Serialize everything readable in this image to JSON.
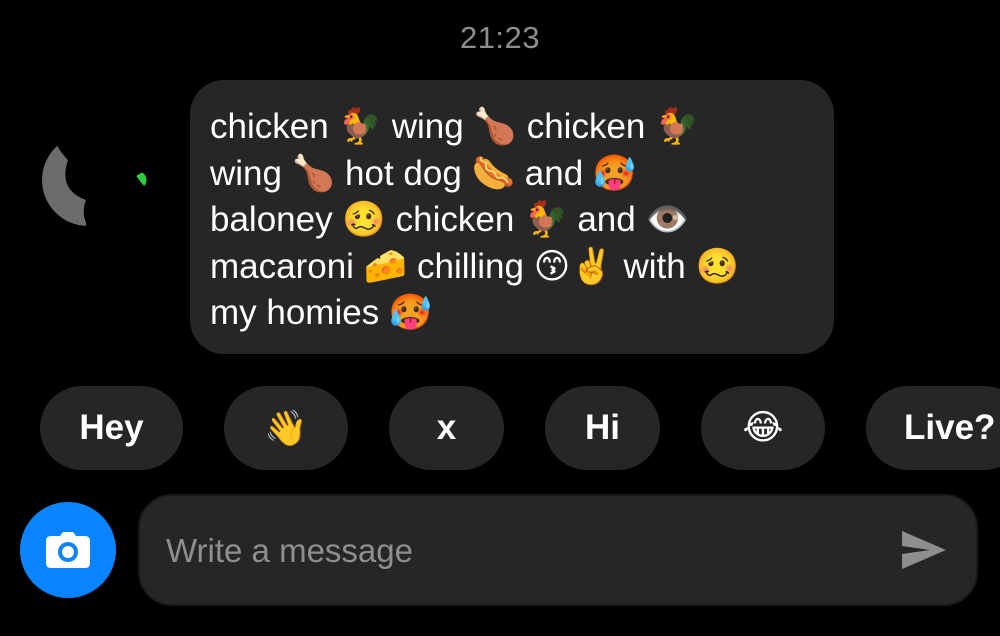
{
  "thread": {
    "timestamp": "21:23"
  },
  "message": {
    "lines": [
      "chicken 🐓 wing 🍗 chicken 🐓",
      "wing 🍗 hot dog 🌭 and 🥵",
      "baloney 🥴 chicken 🐓 and 👁️",
      "macaroni 🧀 chilling 😙✌️ with 🥴",
      "my homies 🥵"
    ],
    "icons": [
      "chicken-emoji",
      "poultry-leg-emoji",
      "hot-dog-emoji",
      "hot-face-emoji",
      "woozy-face-emoji",
      "rooster-emoji",
      "eye-emoji",
      "cheese-emoji",
      "kissing-smiling-eyes-emoji",
      "victory-hand-emoji"
    ]
  },
  "quick_replies": [
    {
      "label": "Hey"
    },
    {
      "label": "👋",
      "icon": "waving-hand-emoji"
    },
    {
      "label": "x"
    },
    {
      "label": "Hi"
    },
    {
      "label": "😂",
      "icon": "tears-of-joy-emoji"
    },
    {
      "label": "Live?"
    }
  ],
  "composer": {
    "placeholder": "Write a message",
    "value": ""
  },
  "icons": {
    "camera": "camera-icon",
    "send": "send-icon"
  },
  "colors": {
    "background": "#000000",
    "bubble": "#262626",
    "accent": "#0a84ff",
    "muted_text": "#8e8e8e"
  }
}
